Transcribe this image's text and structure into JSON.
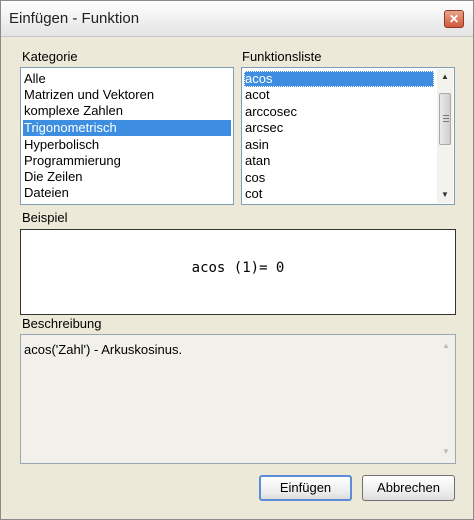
{
  "window": {
    "title": "Einfügen - Funktion",
    "close_glyph": "✕"
  },
  "category": {
    "label": "Kategorie",
    "items": [
      "Alle",
      "Matrizen und Vektoren",
      "komplexe Zahlen",
      "Trigonometrisch",
      "Hyperbolisch",
      "Programmierung",
      "Die Zeilen",
      "Dateien"
    ],
    "selected": "Trigonometrisch"
  },
  "functions": {
    "label": "Funktionsliste",
    "items": [
      "acos",
      "acot",
      "arccosec",
      "arcsec",
      "asin",
      "atan",
      "cos",
      "cot"
    ],
    "selected": "acos"
  },
  "example": {
    "label": "Beispiel",
    "formula": "acos (1)= 0"
  },
  "description": {
    "label": "Beschreibung",
    "text": "acos('Zahl') - Arkuskosinus."
  },
  "buttons": {
    "insert": "Einfügen",
    "cancel": "Abbrechen"
  },
  "icons": {
    "scroll_up": "arrow-up-icon",
    "scroll_down": "arrow-down-icon",
    "close": "close-icon"
  },
  "colors": {
    "selection": "#3d8ee0",
    "dialog_bg": "#ece9d8"
  }
}
